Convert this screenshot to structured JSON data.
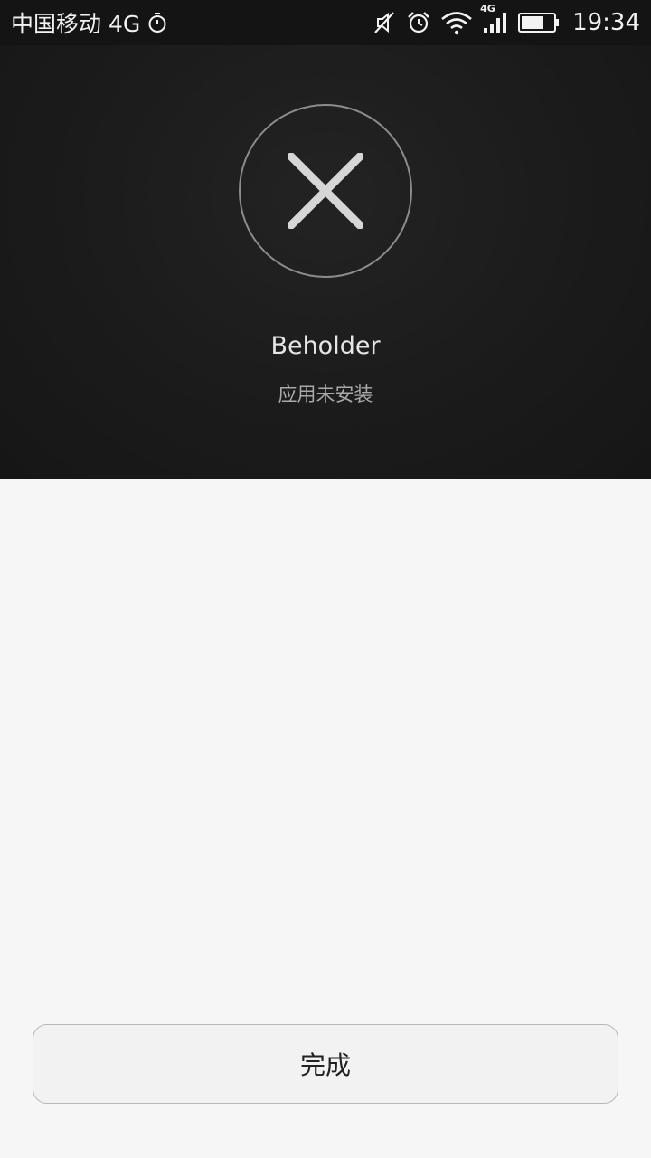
{
  "status_bar": {
    "carrier": "中国移动 4G",
    "network_badge": "4G",
    "time": "19:34",
    "icons": [
      "timer-icon",
      "mute-icon",
      "alarm-icon",
      "wifi-icon",
      "signal-icon",
      "battery-icon"
    ]
  },
  "result": {
    "icon": "close-icon",
    "app_name": "Beholder",
    "message": "应用未安装"
  },
  "footer": {
    "done_label": "完成"
  }
}
